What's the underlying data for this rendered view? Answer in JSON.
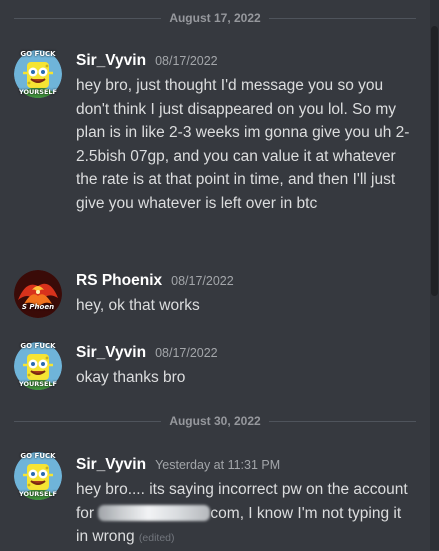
{
  "dividers": [
    "August 17, 2022",
    "August 30, 2022"
  ],
  "messages": [
    {
      "author": "Sir_Vyvin",
      "timestamp": "08/17/2022",
      "avatar_text_top": "GO FUCK",
      "avatar_text_bottom": "YOURSELF",
      "content": "hey bro, just thought I'd message you so you don't think I just disappeared on you lol. So my plan is in like 2-3 weeks im gonna give you uh 2-2.5bish 07gp, and you can value it at whatever the rate is at that point in time, and then I'll just give you whatever is left over in btc"
    },
    {
      "author": "RS Phoenix",
      "timestamp": "08/17/2022",
      "avatar_text": "S Phoen",
      "content": "hey, ok that works"
    },
    {
      "author": "Sir_Vyvin",
      "timestamp": "08/17/2022",
      "avatar_text_top": "GO FUCK",
      "avatar_text_bottom": "YOURSELF",
      "content": "okay thanks bro"
    },
    {
      "author": "Sir_Vyvin",
      "timestamp": "Yesterday at 11:31 PM",
      "avatar_text_top": "GO FUCK",
      "avatar_text_bottom": "YOURSELF",
      "content_before": "hey bro.... its saying incorrect pw on the account for ",
      "content_after": "com, I know I'm not typing it in wrong",
      "edited_label": "(edited)"
    }
  ],
  "colors": {
    "background": "#36393f",
    "author": "#ffffff",
    "message_text": "#dcddde",
    "timestamp": "#a3a6aa",
    "divider_text": "#96989d"
  },
  "icons": {
    "sponge_avatar": "spongebob-imagination-avatar-icon",
    "phoenix_avatar": "phoenix-avatar-icon"
  }
}
